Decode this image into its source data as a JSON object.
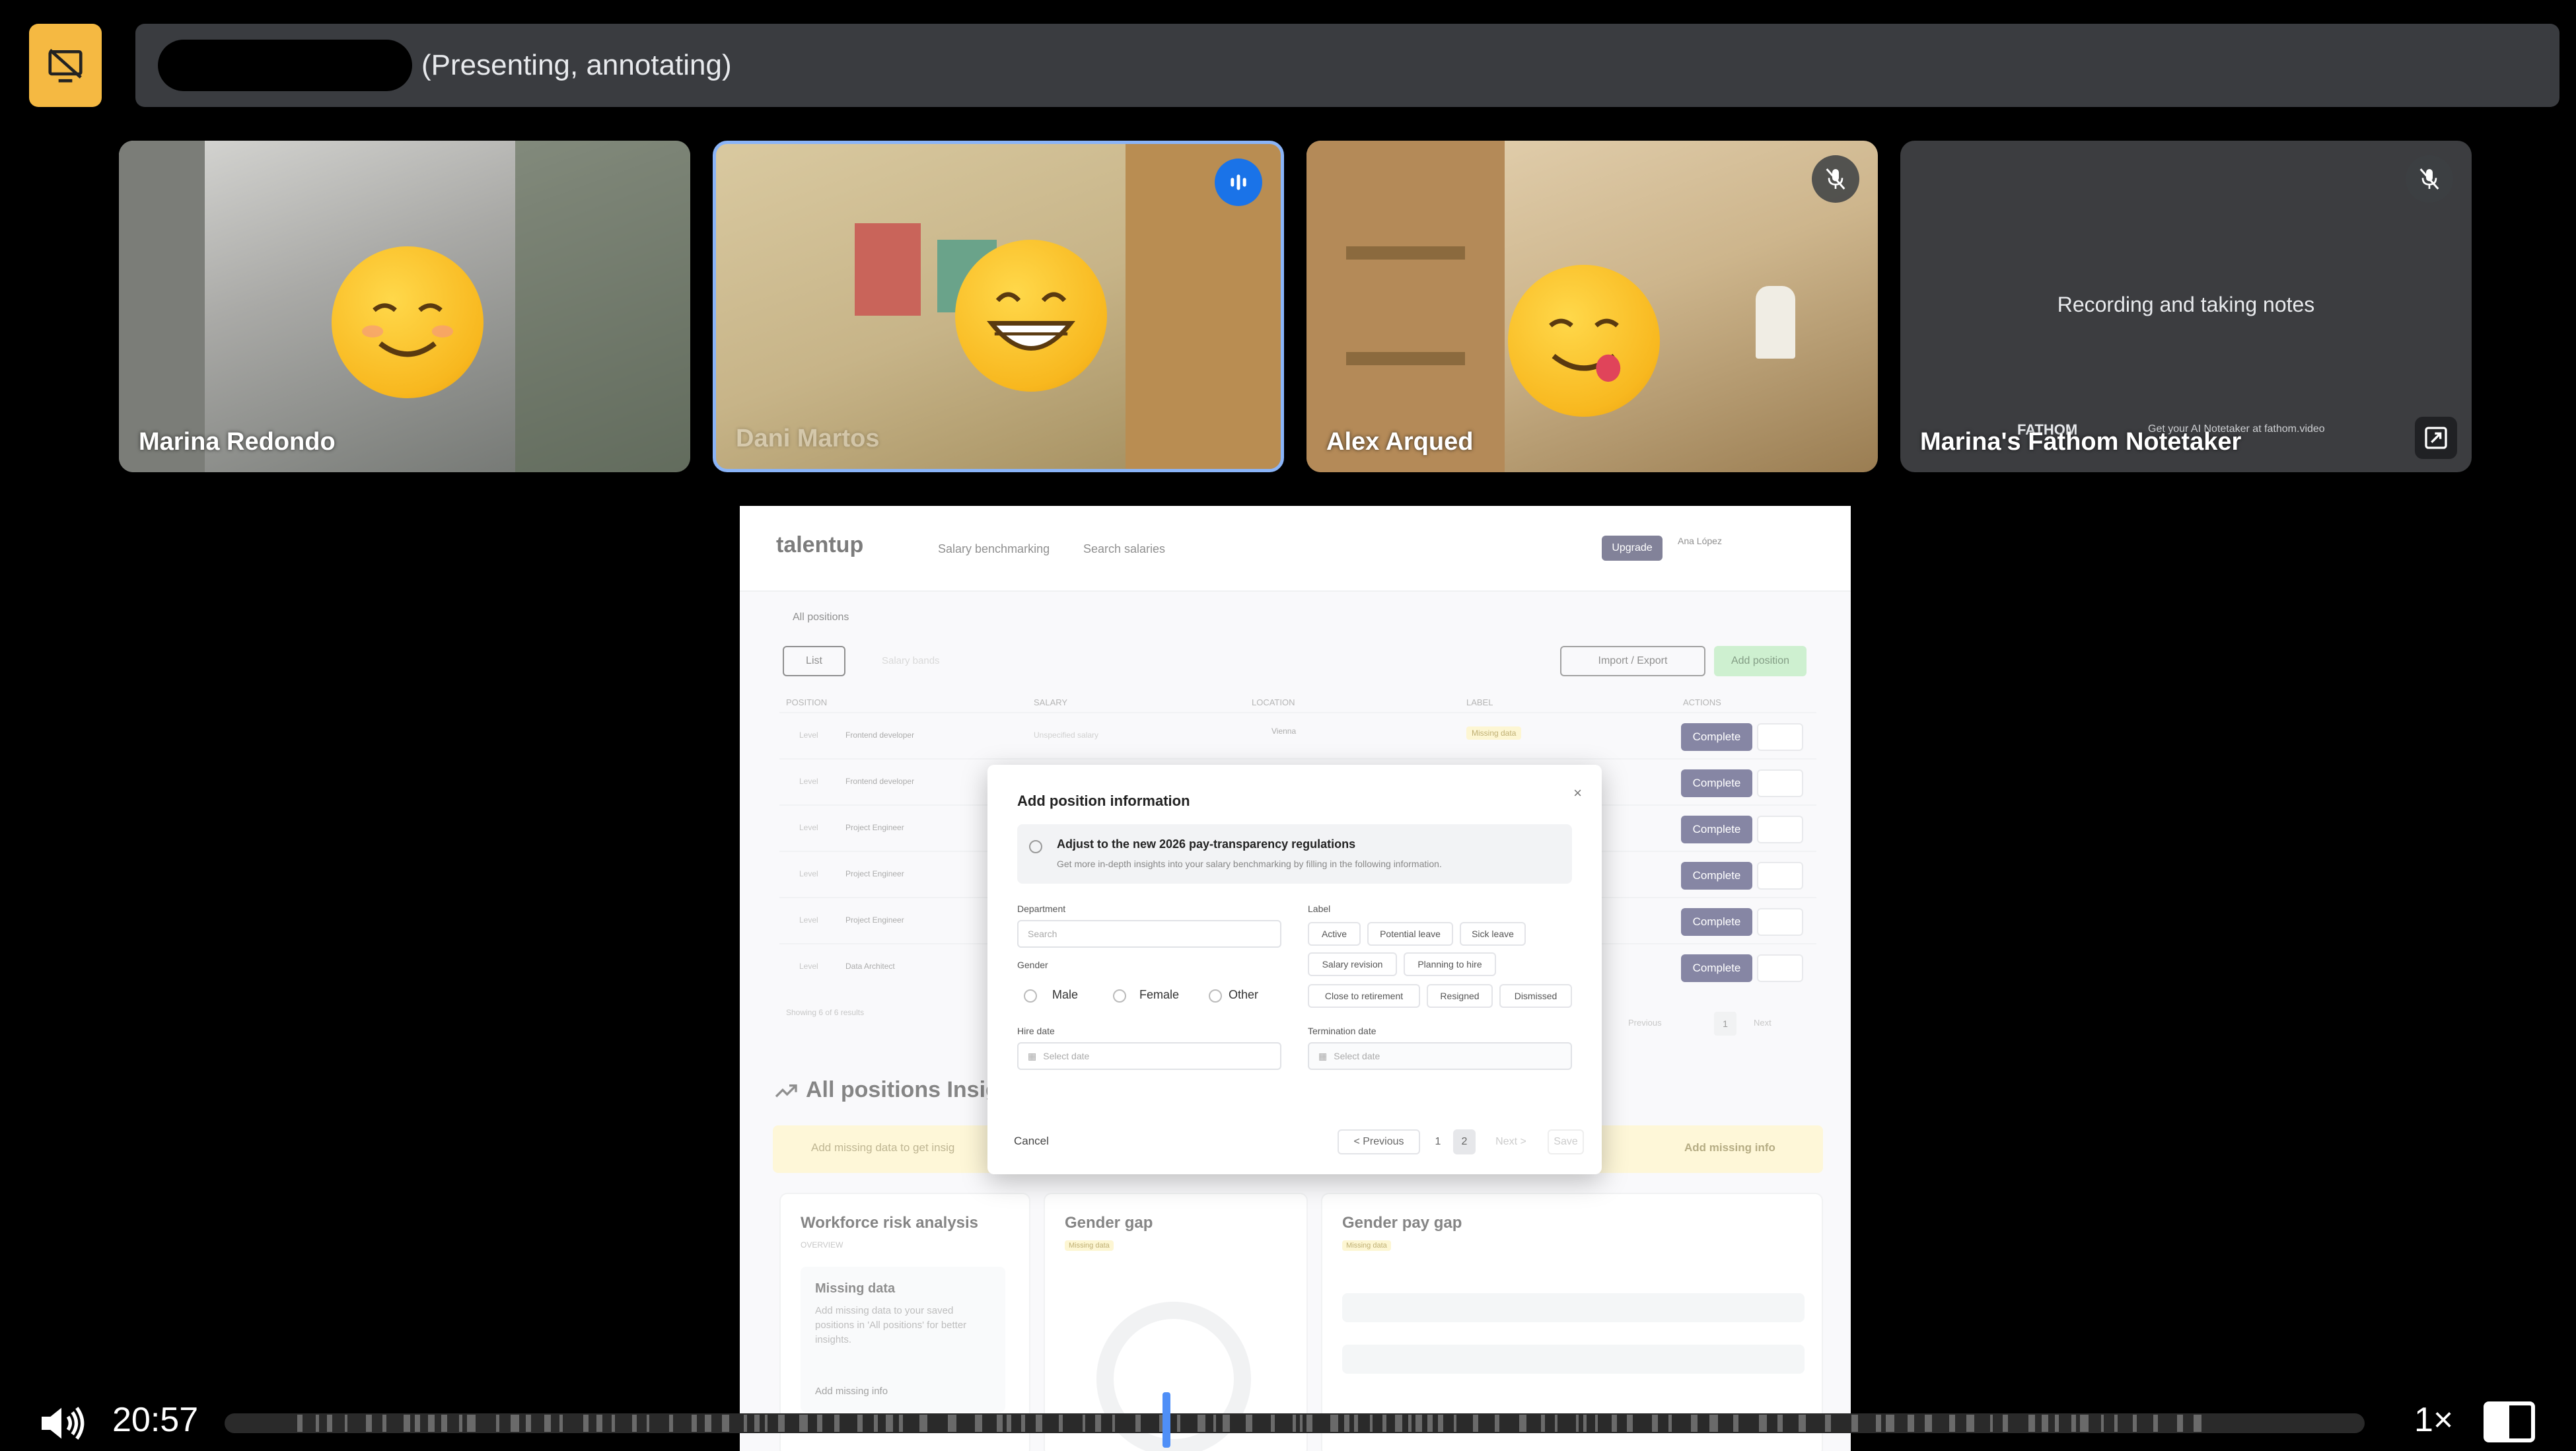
{
  "header": {
    "presenter_status": "(Presenting, annotating)",
    "present_button_icon": "stop-presenting-icon"
  },
  "participants": [
    {
      "name": "Marina Redondo",
      "emoji": "😊",
      "speaking": false,
      "muted": false
    },
    {
      "name": "Dani Martos",
      "emoji": "😁",
      "speaking": true,
      "muted": false
    },
    {
      "name": "Alex Arqued",
      "emoji": "😋",
      "speaking": false,
      "muted": true
    },
    {
      "name": "Marina's Fathom Notetaker",
      "status": "Recording and taking notes",
      "muted": true,
      "brand": "FATHOM",
      "brand_sub": "Get your AI Notetaker at fathom.video"
    }
  ],
  "shared_screen": {
    "logo": "talentup",
    "nav": [
      "Salary benchmarking",
      "Search salaries"
    ],
    "upgrade_label": "Upgrade",
    "user": "Ana López",
    "tab_all_positions": "All positions",
    "list_label": "List",
    "salary_bands_label": "Salary bands",
    "import_export_label": "Import / Export",
    "add_position_label": "Add position",
    "columns": [
      "POSITION",
      "SALARY",
      "LOCATION",
      "LABEL",
      "ACTIONS"
    ],
    "rows": [
      {
        "level": "Level",
        "title": "Frontend developer",
        "salary": "Unspecified salary",
        "location": "Vienna",
        "label": "Missing data",
        "action": "Complete"
      },
      {
        "level": "Level",
        "title": "Frontend developer",
        "action": "Complete"
      },
      {
        "level": "Level",
        "title": "Project Engineer",
        "action": "Complete"
      },
      {
        "level": "Level",
        "title": "Project Engineer",
        "action": "Complete"
      },
      {
        "level": "Level",
        "title": "Project Engineer",
        "action": "Complete"
      },
      {
        "level": "Level",
        "title": "Data Architect",
        "action": "Complete"
      }
    ],
    "showing_label": "Showing 6 of 6 results",
    "pager_prev": "Previous",
    "pager_page": "1",
    "pager_next": "Next",
    "insights_title": "All positions Insig",
    "missing_banner": "Add missing data to get insig",
    "add_missing_label": "Add missing info",
    "cards": [
      {
        "title": "Workforce risk analysis",
        "subtitle": "OVERVIEW",
        "inner_title": "Missing data",
        "inner_text": "Add missing data to your saved positions in 'All positions' for better insights.",
        "inner_link": "Add missing info"
      },
      {
        "title": "Gender gap",
        "badge": "Missing data"
      },
      {
        "title": "Gender pay gap",
        "badge": "Missing data"
      }
    ]
  },
  "modal": {
    "title": "Add position information",
    "banner_title": "Adjust to the new 2026 pay-transparency regulations",
    "banner_sub": "Get more in-depth insights into your salary benchmarking by filling in the following information.",
    "department_label": "Department",
    "department_placeholder": "Search",
    "label_label": "Label",
    "label_chips": [
      "Active",
      "Potential leave",
      "Sick leave",
      "Salary revision",
      "Planning to hire",
      "Close to retirement",
      "Resigned",
      "Dismissed"
    ],
    "gender_label": "Gender",
    "gender_options": [
      "Male",
      "Female",
      "Other"
    ],
    "hire_date_label": "Hire date",
    "hire_date_placeholder": "Select date",
    "termination_date_label": "Termination date",
    "termination_placeholder": "Select date",
    "cancel_label": "Cancel",
    "prev_label": "< Previous",
    "page1": "1",
    "page2": "2",
    "next_label": "Next >",
    "save_label": "Save"
  },
  "player": {
    "timestamp": "20:57",
    "speed": "1×",
    "progress": 0.44
  },
  "colors": {
    "present_button": "#f5b942",
    "speaking_border": "#8ab4f8",
    "playhead": "#4f8ff7",
    "complete_button": "#24245a"
  }
}
